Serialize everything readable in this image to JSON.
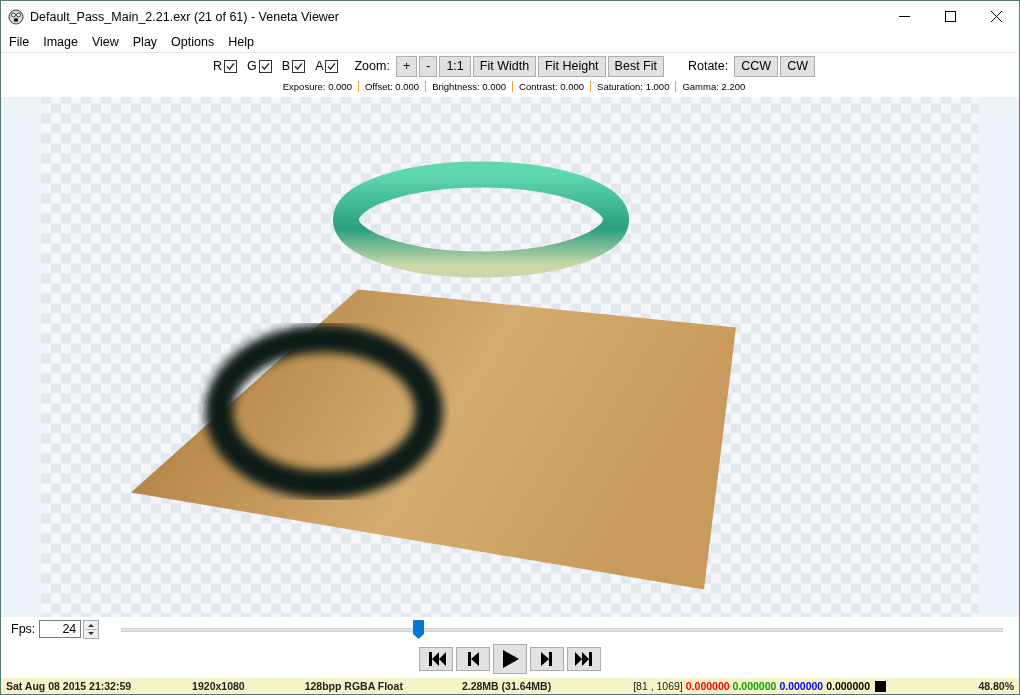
{
  "window": {
    "title": "Default_Pass_Main_2.21.exr (21 of 61) - Veneta Viewer"
  },
  "menu": [
    "File",
    "Image",
    "View",
    "Play",
    "Options",
    "Help"
  ],
  "channels": [
    {
      "label": "R",
      "checked": true
    },
    {
      "label": "G",
      "checked": true
    },
    {
      "label": "B",
      "checked": true
    },
    {
      "label": "A",
      "checked": true
    }
  ],
  "zoom": {
    "label": "Zoom:",
    "buttons": [
      "+",
      "-",
      "1:1",
      "Fit Width",
      "Fit Height",
      "Best Fit"
    ]
  },
  "rotate": {
    "label": "Rotate:",
    "buttons": [
      "CCW",
      "CW"
    ]
  },
  "adjustments": [
    "Exposure: 0.000",
    "Offset: 0.000",
    "Brightness: 0.000",
    "Contrast: 0.000",
    "Saturation: 1.000",
    "Gamma: 2.200"
  ],
  "playback": {
    "fps_label": "Fps:",
    "fps_value": "24",
    "level": 0.336
  },
  "transport": [
    {
      "kind": "first"
    },
    {
      "kind": "prev"
    },
    {
      "kind": "play"
    },
    {
      "kind": "next"
    },
    {
      "kind": "last"
    }
  ],
  "status": {
    "date": "Sat Aug 08 2015 21:32:59",
    "resolution": "1920x1080",
    "format": "128bpp RGBA Float",
    "size": "2.28MB (31.64MB)",
    "coords": "[81 , 1069]",
    "values": [
      {
        "text": "0.000000",
        "color": "#ff0000"
      },
      {
        "text": "0.000000",
        "color": "#00aa00"
      },
      {
        "text": "0.000000",
        "color": "#0000ff"
      },
      {
        "text": "0.000000",
        "color": "#000000"
      }
    ],
    "swatch": {
      "color": "#000000"
    },
    "zoom": "48.80%"
  }
}
